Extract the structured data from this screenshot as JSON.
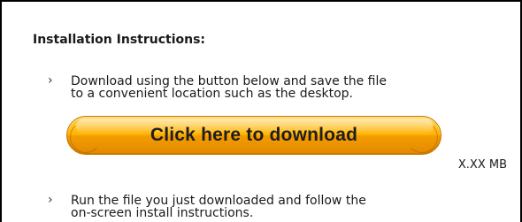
{
  "instructions": {
    "heading": "Installation Instructions:",
    "bullet_glyph": "›",
    "steps": [
      {
        "line1": "Download using the button below and save the file",
        "line2": "to a convenient location such as the desktop."
      },
      {
        "line1": "Run the file you just downloaded and follow the",
        "line2": "on-screen install instructions."
      }
    ]
  },
  "download": {
    "label": "Click here to download",
    "file_size": "X.XX MB",
    "colors": {
      "button_top": "#ffd35a",
      "button_mid": "#ffb300",
      "button_bottom": "#e28a00",
      "button_border": "#c57600"
    }
  }
}
